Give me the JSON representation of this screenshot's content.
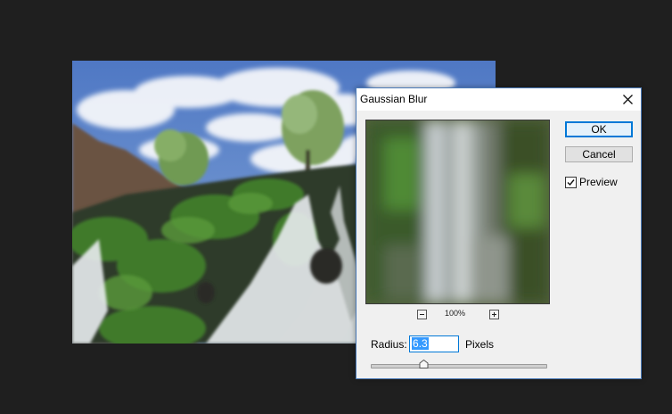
{
  "dialog": {
    "title": "Gaussian Blur",
    "ok_label": "OK",
    "cancel_label": "Cancel",
    "preview_label": "Preview",
    "preview_checked": true,
    "zoom_level": "100%",
    "radius_label": "Radius:",
    "radius_value": "6.3",
    "units_label": "Pixels",
    "slider_fraction": 0.3
  },
  "icons": {
    "close": "close-icon",
    "zoom_out": "zoom-out-icon",
    "zoom_in": "zoom-in-icon",
    "checkmark": "checkmark-icon",
    "slider_thumb": "slider-thumb-icon"
  },
  "colors": {
    "canvas_background": "#1f1f1f",
    "dialog_background": "#f0f0f0",
    "accent": "#0078d7",
    "selection": "#3399ff"
  }
}
